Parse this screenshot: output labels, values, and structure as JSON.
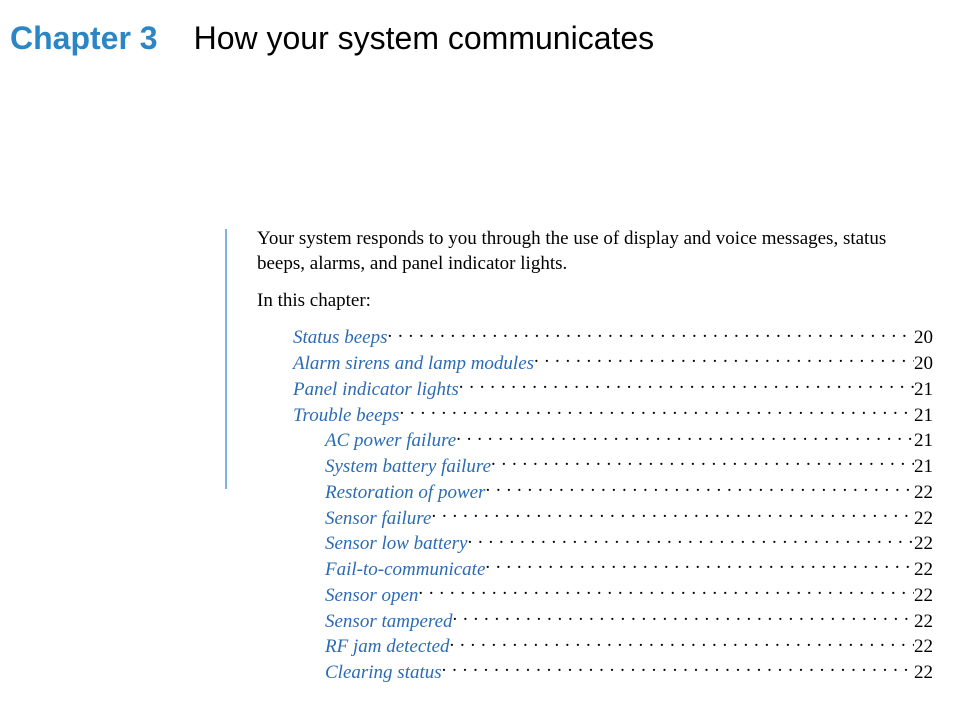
{
  "chapter": {
    "label": "Chapter 3",
    "title": "How your system communicates"
  },
  "intro": "Your system responds to you through the use of display and voice messages, status beeps, alarms, and panel indicator lights.",
  "in_this_chapter": "In this chapter:",
  "toc": [
    {
      "title": "Status beeps",
      "page": "20",
      "level": 0
    },
    {
      "title": "Alarm sirens and lamp modules",
      "page": "20",
      "level": 0
    },
    {
      "title": "Panel indicator lights",
      "page": "21",
      "level": 0
    },
    {
      "title": "Trouble beeps",
      "page": "21",
      "level": 0
    },
    {
      "title": "AC power failure",
      "page": "21",
      "level": 1
    },
    {
      "title": "System battery failure",
      "page": "21",
      "level": 1
    },
    {
      "title": "Restoration of power",
      "page": "22",
      "level": 1
    },
    {
      "title": "Sensor failure",
      "page": "22",
      "level": 1
    },
    {
      "title": "Sensor low battery",
      "page": "22",
      "level": 1
    },
    {
      "title": "Fail-to-communicate",
      "page": "22",
      "level": 1
    },
    {
      "title": "Sensor open",
      "page": "22",
      "level": 1
    },
    {
      "title": "Sensor tampered",
      "page": "22",
      "level": 1
    },
    {
      "title": "RF jam detected",
      "page": "22",
      "level": 1
    },
    {
      "title": "Clearing status",
      "page": "22",
      "level": 1
    }
  ]
}
